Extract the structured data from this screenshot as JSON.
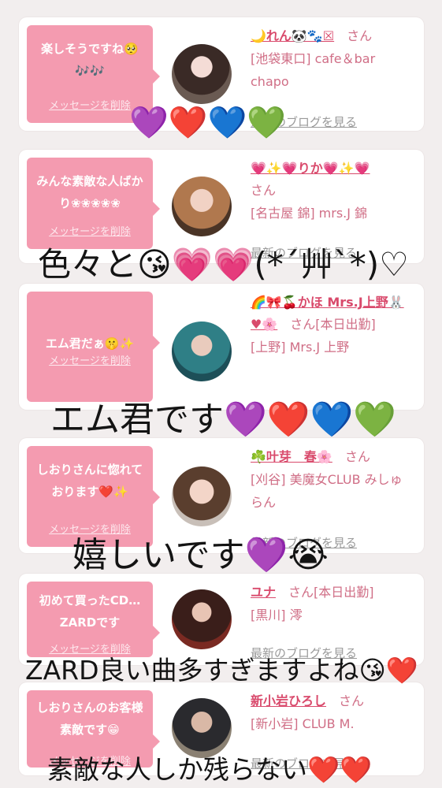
{
  "colors": {
    "page_background": "#f2eeee",
    "bubble_pink": "#f49bb0",
    "name_pink": "#d94a6c",
    "text_pink": "#d06e86",
    "link_gray": "#9a9a9a"
  },
  "cards": [
    {
      "message": "楽しそうですね🥺🎶🎶",
      "delete_label": "メッセージを削除",
      "name": "🌙れん🐼🐾☒",
      "suffix": "さん",
      "shop": "[池袋東口] cafe＆bar chapo",
      "blog_label": "最新のブログを見る"
    },
    {
      "message": "みんな素敵な人ばかり❀❀❀❀❀",
      "delete_label": "メッセージを削除",
      "name": "💗✨💗りか💗✨💗",
      "suffix": "さん",
      "shop": "[名古屋 錦] mrs.J 錦",
      "blog_label": "最新のブログを見る"
    },
    {
      "message": "エム君だぁ🤫✨",
      "delete_label": "メッセージを削除",
      "name": "🌈🎀🍒かほ Mrs.J上野🐰♥🌸",
      "suffix": "さん[本日出勤]",
      "shop": "[上野] Mrs.J 上野",
      "blog_label": "最新のブログを見る"
    },
    {
      "message": "しおりさんに惚れております❤️✨",
      "delete_label": "メッセージを削除",
      "name": "☘️叶芽　春🌸",
      "suffix": "さん",
      "shop": "[刈谷] 美魔女CLUB みしゅらん",
      "blog_label": "最新のブログを見る"
    },
    {
      "message": "初めて買ったCD…ZARDです",
      "delete_label": "メッセージを削除",
      "name": "ユナ",
      "suffix": "さん[本日出勤]",
      "shop": "[黒川] 澪",
      "blog_label": "最新のブログを見る"
    },
    {
      "message": "しおりさんのお客様素敵です😁",
      "delete_label": "メッセージを削除",
      "name": "新小岩ひろし",
      "suffix": "さん",
      "shop": "[新小岩] CLUB M.",
      "blog_label": "最新のブログを見る"
    }
  ],
  "overlay_captions": {
    "hearts_1": "💜❤️💙💚",
    "caption_2": "色々と😘💗💗(*´艸`*)♡",
    "caption_3": "エム君です💜❤️💙💚",
    "caption_4": "嬉しいです💜😭",
    "caption_5": "ZARD良い曲多すぎますよね😘❤️",
    "caption_6": "素敵な人しか残らない❤️❤️"
  }
}
